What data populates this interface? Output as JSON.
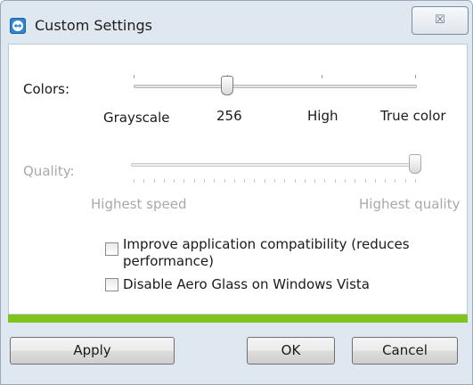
{
  "window": {
    "title": "Custom Settings",
    "close_glyph": "☒"
  },
  "icons": {
    "app": "teamviewer-icon",
    "close": "close-icon"
  },
  "colors_slider": {
    "label": "Colors:",
    "tick_labels": [
      "Grayscale",
      "256",
      "High",
      "True color"
    ],
    "selected_index": 1,
    "enabled": true
  },
  "quality_slider": {
    "label": "Quality:",
    "min_label": "Highest speed",
    "max_label": "Highest quality",
    "level": 1.0,
    "enabled": false
  },
  "options": [
    {
      "label_line1": "Improve application compatibility (reduces",
      "label_line2": "performance)",
      "checked": false
    },
    {
      "label_line1": "Disable Aero Glass on Windows Vista",
      "checked": false
    }
  ],
  "buttons": {
    "apply": "Apply",
    "ok": "OK",
    "cancel": "Cancel"
  },
  "theme": {
    "accent_green": "#7fc31c",
    "frame": "#dfe8f1"
  }
}
